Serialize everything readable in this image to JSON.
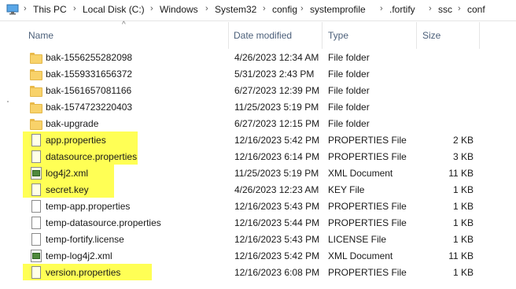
{
  "breadcrumb": {
    "items": [
      "This PC",
      "Local Disk (C:)",
      "Windows",
      "System32",
      "config",
      "systemprofile",
      ".fortify",
      "ssc",
      "conf"
    ],
    "separator": "›"
  },
  "columns": {
    "name": "Name",
    "date_modified": "Date modified",
    "type": "Type",
    "size": "Size"
  },
  "colors": {
    "highlight": "#ffff55",
    "header_text": "#4c607a",
    "folder": "#f8d26a"
  },
  "files": [
    {
      "name": "bak-1556255282098",
      "date": "4/26/2023 12:34 AM",
      "type": "File folder",
      "size": "",
      "icon": "folder-icon",
      "highlighted": false
    },
    {
      "name": "bak-1559331656372",
      "date": "5/31/2023 2:43 PM",
      "type": "File folder",
      "size": "",
      "icon": "folder-icon",
      "highlighted": false
    },
    {
      "name": "bak-1561657081166",
      "date": "6/27/2023 12:39 PM",
      "type": "File folder",
      "size": "",
      "icon": "folder-icon",
      "highlighted": false
    },
    {
      "name": "bak-1574723220403",
      "date": "11/25/2023 5:19 PM",
      "type": "File folder",
      "size": "",
      "icon": "folder-icon",
      "highlighted": false
    },
    {
      "name": "bak-upgrade",
      "date": "6/27/2023 12:15 PM",
      "type": "File folder",
      "size": "",
      "icon": "folder-icon",
      "highlighted": false
    },
    {
      "name": "app.properties",
      "date": "12/16/2023 5:42 PM",
      "type": "PROPERTIES File",
      "size": "2 KB",
      "icon": "document-icon",
      "highlighted": true
    },
    {
      "name": "datasource.properties",
      "date": "12/16/2023 6:14 PM",
      "type": "PROPERTIES File",
      "size": "3 KB",
      "icon": "document-icon",
      "highlighted": true
    },
    {
      "name": "log4j2.xml",
      "date": "11/25/2023 5:19 PM",
      "type": "XML Document",
      "size": "11 KB",
      "icon": "xml-document-icon",
      "highlighted": true
    },
    {
      "name": "secret.key",
      "date": "4/26/2023 12:23 AM",
      "type": "KEY File",
      "size": "1 KB",
      "icon": "document-icon",
      "highlighted": true
    },
    {
      "name": "temp-app.properties",
      "date": "12/16/2023 5:43 PM",
      "type": "PROPERTIES File",
      "size": "1 KB",
      "icon": "document-icon",
      "highlighted": false
    },
    {
      "name": "temp-datasource.properties",
      "date": "12/16/2023 5:44 PM",
      "type": "PROPERTIES File",
      "size": "1 KB",
      "icon": "document-icon",
      "highlighted": false
    },
    {
      "name": "temp-fortify.license",
      "date": "12/16/2023 5:43 PM",
      "type": "LICENSE File",
      "size": "1 KB",
      "icon": "document-icon",
      "highlighted": false
    },
    {
      "name": "temp-log4j2.xml",
      "date": "12/16/2023 5:42 PM",
      "type": "XML Document",
      "size": "11 KB",
      "icon": "xml-document-icon",
      "highlighted": false
    },
    {
      "name": "version.properties",
      "date": "12/16/2023 6:08 PM",
      "type": "PROPERTIES File",
      "size": "1 KB",
      "icon": "document-icon",
      "highlighted": true
    }
  ]
}
